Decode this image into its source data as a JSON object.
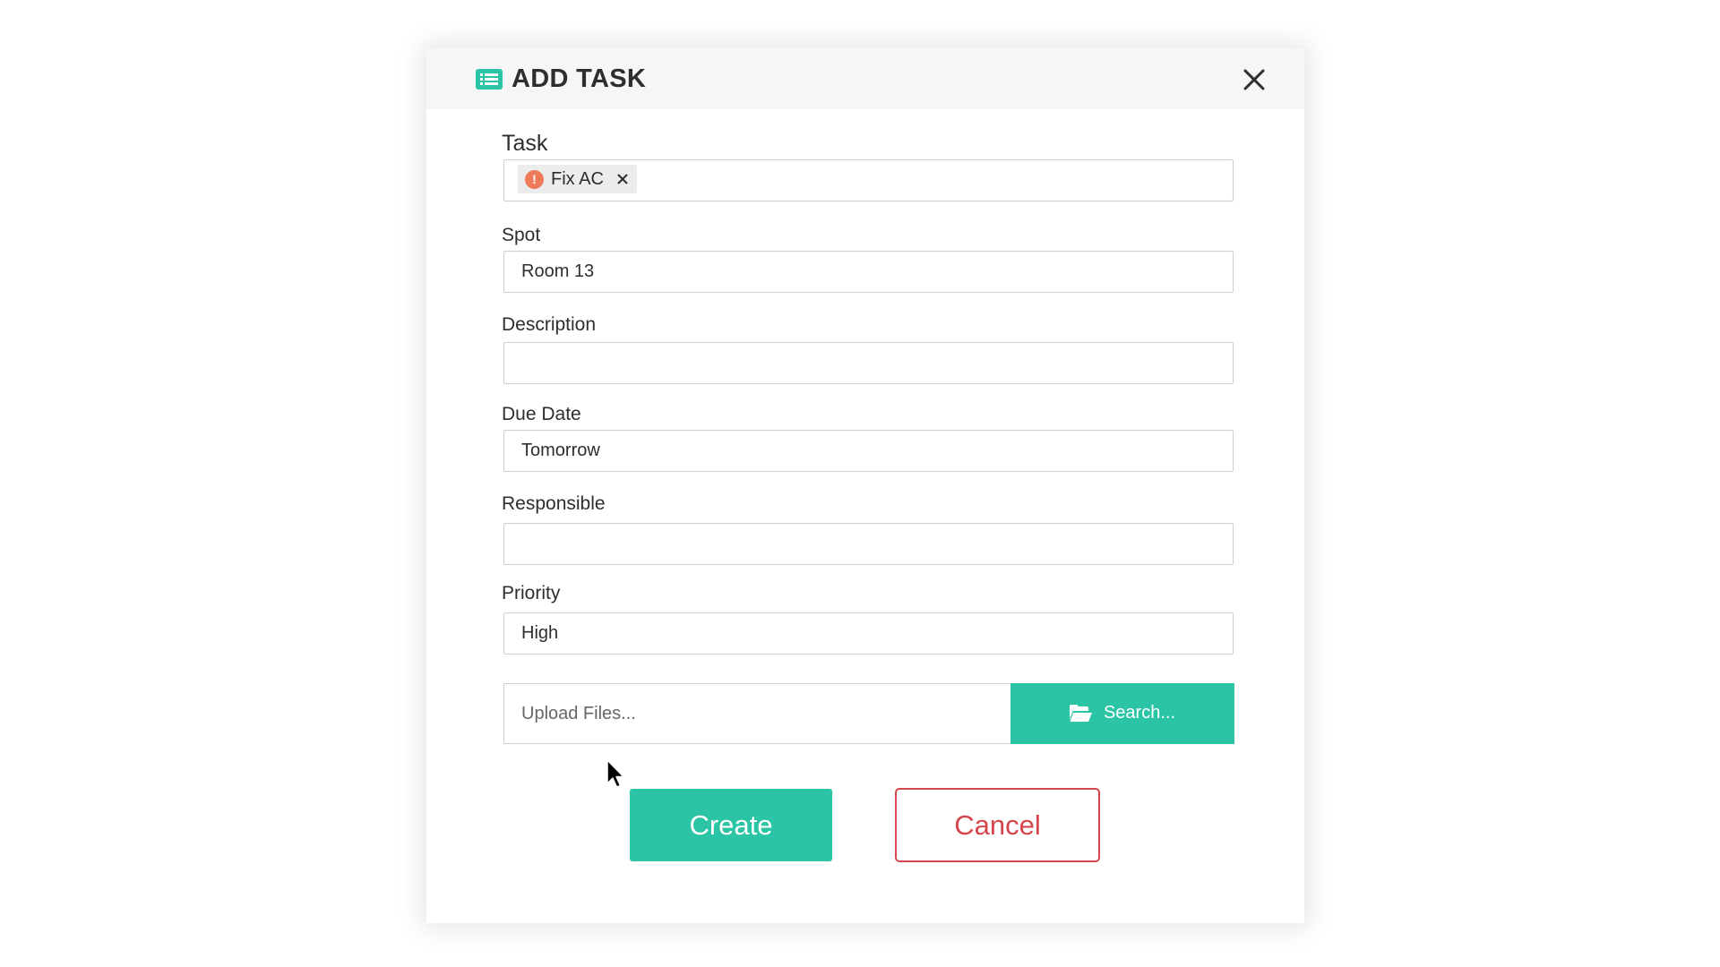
{
  "dialog": {
    "title": "ADD TASK",
    "accent_color": "#2bc4a5",
    "danger_color": "#d5464c"
  },
  "fields": {
    "task": {
      "label": "Task",
      "chip_label": "Fix AC",
      "chip_icon": "exclamation-circle-icon",
      "chip_icon_color": "#ef7a59"
    },
    "spot": {
      "label": "Spot",
      "value": "Room 13"
    },
    "description": {
      "label": "Description",
      "value": ""
    },
    "due_date": {
      "label": "Due Date",
      "value": "Tomorrow"
    },
    "responsible": {
      "label": "Responsible",
      "value": ""
    },
    "priority": {
      "label": "Priority",
      "value": "High"
    }
  },
  "upload": {
    "placeholder": "Upload Files...",
    "search_label": "Search..."
  },
  "actions": {
    "create_label": "Create",
    "cancel_label": "Cancel"
  }
}
